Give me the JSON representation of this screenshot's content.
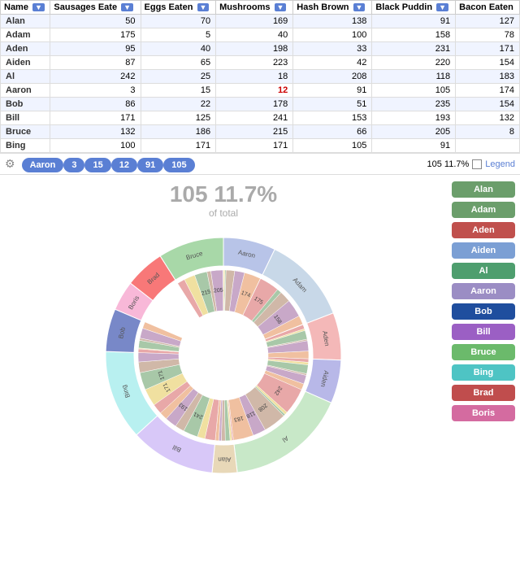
{
  "table": {
    "columns": [
      "Name",
      "Sausages Eaten",
      "Eggs Eaten",
      "Mushrooms",
      "Hash Brown",
      "Black Pudding",
      "Bacon Eaten"
    ],
    "rows": [
      [
        "Alan",
        50,
        70,
        169,
        138,
        91,
        127
      ],
      [
        "Adam",
        175,
        5,
        40,
        100,
        158,
        78
      ],
      [
        "Aden",
        95,
        40,
        198,
        33,
        231,
        171
      ],
      [
        "Aiden",
        87,
        65,
        223,
        42,
        220,
        154
      ],
      [
        "Al",
        242,
        25,
        18,
        208,
        118,
        183
      ],
      [
        "Aaron",
        3,
        15,
        12,
        91,
        105,
        174
      ],
      [
        "Bob",
        86,
        22,
        178,
        51,
        235,
        154
      ],
      [
        "Bill",
        171,
        125,
        241,
        153,
        193,
        132
      ],
      [
        "Bruce",
        132,
        186,
        215,
        66,
        205,
        8
      ],
      [
        "Bing",
        100,
        171,
        171,
        105,
        91,
        ""
      ]
    ]
  },
  "filter_bar": {
    "pills": [
      "Aaron",
      "3",
      "15",
      "12",
      "91",
      "105"
    ],
    "right_label": "105 11.7%",
    "legend_label": "Legend"
  },
  "chart": {
    "center_value": "105 11.7%",
    "center_sub": "of total"
  },
  "legend": {
    "items": [
      {
        "label": "Alan",
        "color": "#6b9e6b"
      },
      {
        "label": "Adam",
        "color": "#6b9e6b"
      },
      {
        "label": "Aden",
        "color": "#c0504d"
      },
      {
        "label": "Aiden",
        "color": "#7b9fd4"
      },
      {
        "label": "Al",
        "color": "#4e9e6e"
      },
      {
        "label": "Aaron",
        "color": "#9b8dc4"
      },
      {
        "label": "Bob",
        "color": "#1f4e9e"
      },
      {
        "label": "Bill",
        "color": "#9b5fc4"
      },
      {
        "label": "Bruce",
        "color": "#6bba6b"
      },
      {
        "label": "Bing",
        "color": "#4ec4c4"
      },
      {
        "label": "Brad",
        "color": "#c04d4d"
      },
      {
        "label": "Boris",
        "color": "#d46ba0"
      }
    ]
  }
}
